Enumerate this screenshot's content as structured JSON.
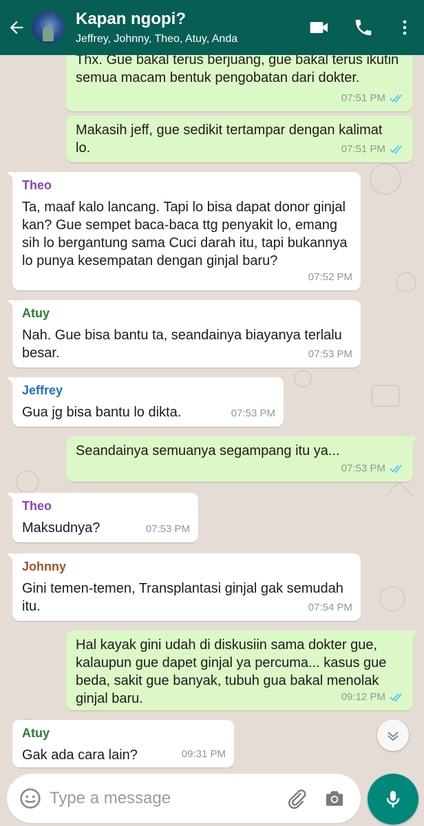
{
  "header": {
    "title": "Kapan ngopi?",
    "participants": "Jeffrey, Johnny, Theo, Atuy, Anda",
    "icons": [
      "back-arrow-icon",
      "video-call-icon",
      "phone-icon",
      "more-vert-icon"
    ]
  },
  "colors": {
    "header": "#075e54",
    "outgoing_bubble": "#dcf8c6",
    "incoming_bubble": "#ffffff",
    "read_ticks": "#4fc3f7",
    "mic_button": "#00897b",
    "chat_background": "#e5ddd5"
  },
  "messages": [
    {
      "direction": "out",
      "text": "Thx. Gue bakal terus berjuang, gue bakal terus ikutin semua macam bentuk pengobatan dari dokter.",
      "time": "07:51 PM",
      "status": "read"
    },
    {
      "direction": "out",
      "text": "Makasih jeff, gue sedikit tertampar dengan kalimat lo.",
      "time": "07:51 PM",
      "status": "read"
    },
    {
      "direction": "in",
      "sender": "Theo",
      "sender_color": "#8e44ad",
      "text": "Ta, maaf kalo lancang. Tapi lo bisa dapat donor ginjal kan? Gue sempet baca-baca ttg penyakit lo, emang sih lo bergantung sama Cuci darah itu, tapi bukannya lo punya kesempatan dengan ginjal baru?",
      "time": "07:52 PM"
    },
    {
      "direction": "in",
      "sender": "Atuy",
      "sender_color": "#2e7d32",
      "text": "Nah. Gue bisa bantu ta, seandainya biayanya terlalu besar.",
      "time": "07:53 PM"
    },
    {
      "direction": "in",
      "sender": "Jeffrey",
      "sender_color": "#1e6fc8",
      "text": "Gua jg bisa bantu lo dikta.",
      "time": "07:53 PM"
    },
    {
      "direction": "out",
      "text": "Seandainya semuanya segampang itu ya...",
      "time": "07:53 PM",
      "status": "read"
    },
    {
      "direction": "in",
      "sender": "Theo",
      "sender_color": "#8e44ad",
      "text": "Maksudnya?",
      "time": "07:53 PM"
    },
    {
      "direction": "in",
      "sender": "Johnny",
      "sender_color": "#a0522d",
      "text": "Gini temen-temen, Transplantasi ginjal gak semudah itu.",
      "time": "07:54 PM"
    },
    {
      "direction": "out",
      "text": "Hal kayak gini udah di diskusiin sama dokter gue, kalaupun gue dapet ginjal ya percuma... kasus gue beda, sakit gue banyak, tubuh gua bakal menolak ginjal baru.",
      "time": "09:12 PM",
      "status": "read"
    },
    {
      "direction": "in",
      "sender": "Atuy",
      "sender_color": "#2e7d32",
      "text": "Gak ada cara lain?",
      "time": "09:31 PM"
    }
  ],
  "composer": {
    "placeholder": "Type a message",
    "icons": [
      "emoji-icon",
      "attach-icon",
      "camera-icon",
      "mic-icon"
    ]
  },
  "scroll_down_icon": "chevron-down-icon"
}
